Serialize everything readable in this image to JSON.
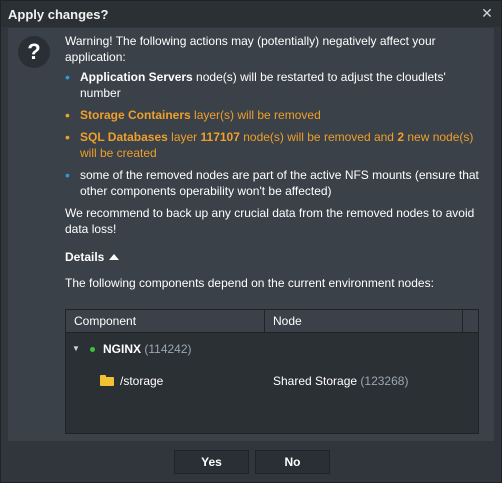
{
  "dialog": {
    "title": "Apply changes?"
  },
  "message": {
    "warning": "Warning! The following actions may (potentially) negatively affect your application:",
    "items": [
      {
        "bold": "Application Servers",
        "text": " node(s) will be restarted to adjust the cloudlets' number"
      },
      {
        "bold": "Storage Containers",
        "text": " layer(s) will be removed"
      },
      {
        "bold": "SQL Databases",
        "text1": " layer ",
        "bold2": "117107",
        "text2": " node(s) will be removed and ",
        "bold3": "2",
        "text3": " new node(s) will be created"
      },
      {
        "text": "some of the removed nodes are part of the active NFS mounts (ensure that other components operability won't be affected)"
      }
    ],
    "recommend": "We recommend to back up any crucial data from the removed nodes to avoid data loss!"
  },
  "details": {
    "label": "Details",
    "depends": "The following components depend on the current environment nodes:",
    "columns": [
      "Component",
      "Node"
    ],
    "rows": [
      {
        "name": "NGINX",
        "id": "(114242)",
        "node": ""
      },
      {
        "name": "/storage",
        "id": "",
        "node": "Shared Storage",
        "node_id": "(123268)"
      }
    ]
  },
  "buttons": {
    "yes": "Yes",
    "no": "No"
  },
  "colors": {
    "accent_blue": "#2a9be0",
    "warning_orange": "#ef9f2b",
    "status_green": "#3fbf3f",
    "folder_yellow": "#f2c230"
  }
}
